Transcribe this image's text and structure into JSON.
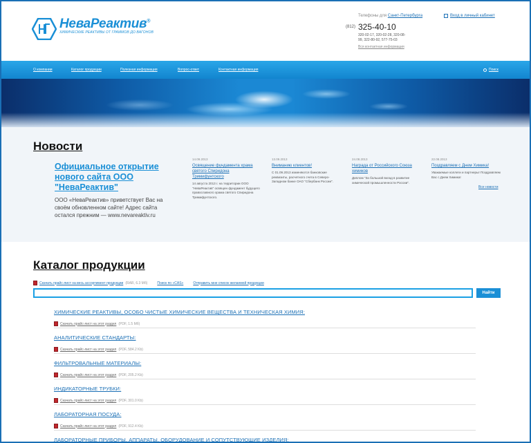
{
  "header": {
    "brand": "НеваРеактив",
    "brand_mark": "®",
    "tagline": "ХИМИЧЕСКИЕ РЕАКТИВЫ ОТ ГРАММОВ ДО ВАГОНОВ",
    "phones_caption": "Телефоны для",
    "phones_city": "Санкт-Петербурга",
    "phone_code": "(812)",
    "phone_main": "325-40-10",
    "phone_more": "320-02-17, 320-02-28, 320-08-99, 322-80-92, 577-75-03",
    "contacts_link": "Вся контактная информация",
    "cabinet_link": "Вход в личный кабинет"
  },
  "nav": {
    "items": [
      "О компании",
      "Каталог продукции",
      "Полезная информация",
      "Вопрос-ответ",
      "Контактная информация"
    ],
    "search": "Поиск"
  },
  "news": {
    "heading": "Новости",
    "main_title": "Официальное открытие нового сайта ООО \"НеваРеактив\"",
    "main_text": "ООО «НеваРеактив» приветствует Вас на своём обновленном сайте! Адрес сайта остался прежним — www.nevareaktiv.ru",
    "items": [
      {
        "date": "14.09.2013",
        "title": "Освящение фундамента храма святого Спиридона Тримифунтского",
        "text": "14 августа 2013 г. на территории ООО \"НеваРеактив\" освящен фундамент будущего православного храма святого Спиридона Тримифунтского."
      },
      {
        "date": "13.09.2013",
        "title": "Вниманию клиентов!",
        "text": "С 01.09.2013 изменяются банковские реквизиты, расчетного счета в Северо-Западном банке ОАО \"Сбербанк России\"."
      },
      {
        "date": "24.08.2013",
        "title": "Награда от Российского Союза химиков",
        "text": "Диплом \"За большой вклад в развитие химической промышленности России\"."
      },
      {
        "date": "22.08.2013",
        "title": "Поздравляем с Днем Химика!",
        "text": "Уважаемые коллеги и партнеры! Поздравляем Вас с Днем Химика!"
      }
    ],
    "all_news": "Все новости"
  },
  "catalog": {
    "heading": "Каталог продукции",
    "download_all": "Скачать прайс-лист на весь ассортимент продукции",
    "download_all_size": "(RAR, 6.3 Мб)",
    "search_cas": "Поиск по «CAS»",
    "send_list": "Отправить мне список желаемой продукции",
    "search_button": "Найти",
    "download_label": "Скачать прайс-лист на этот раздел",
    "categories": [
      {
        "name": "ХИМИЧЕСКИЕ РЕАКТИВЫ, ОСОБО ЧИСТЫЕ ХИМИЧЕСКИЕ ВЕЩЕСТВА И ТЕХНИЧЕСКАЯ ХИМИЯ:",
        "size": "(PDF, 1.5 Мб)"
      },
      {
        "name": "АНАЛИТИЧЕСКИЕ СТАНДАРТЫ:",
        "size": "(PDF, 584.2 Kb)"
      },
      {
        "name": "ФИЛЬТРОВАЛЬНЫЕ МАТЕРИАЛЫ:",
        "size": "(PDF, 205.2 Kb)"
      },
      {
        "name": "ИНДИКАТОРНЫЕ ТРУБКИ:",
        "size": "(PDF, 301.0 Kb)"
      },
      {
        "name": "ЛАБОРАТОРНАЯ ПОСУДА:",
        "size": "(PDF, 912.4 Kb)"
      },
      {
        "name": "ЛАБОРАТОРНЫЕ ПРИБОРЫ, АППАРАТЫ, ОБОРУДОВАНИЕ И СОПУТСТВУЮЩИЕ ИЗДЕЛИЯ:",
        "size": ""
      }
    ]
  },
  "colors": {
    "accent": "#1a8fd6",
    "nav": "#1285cf",
    "link": "#1a6fb5",
    "pdf": "#c0272d"
  }
}
